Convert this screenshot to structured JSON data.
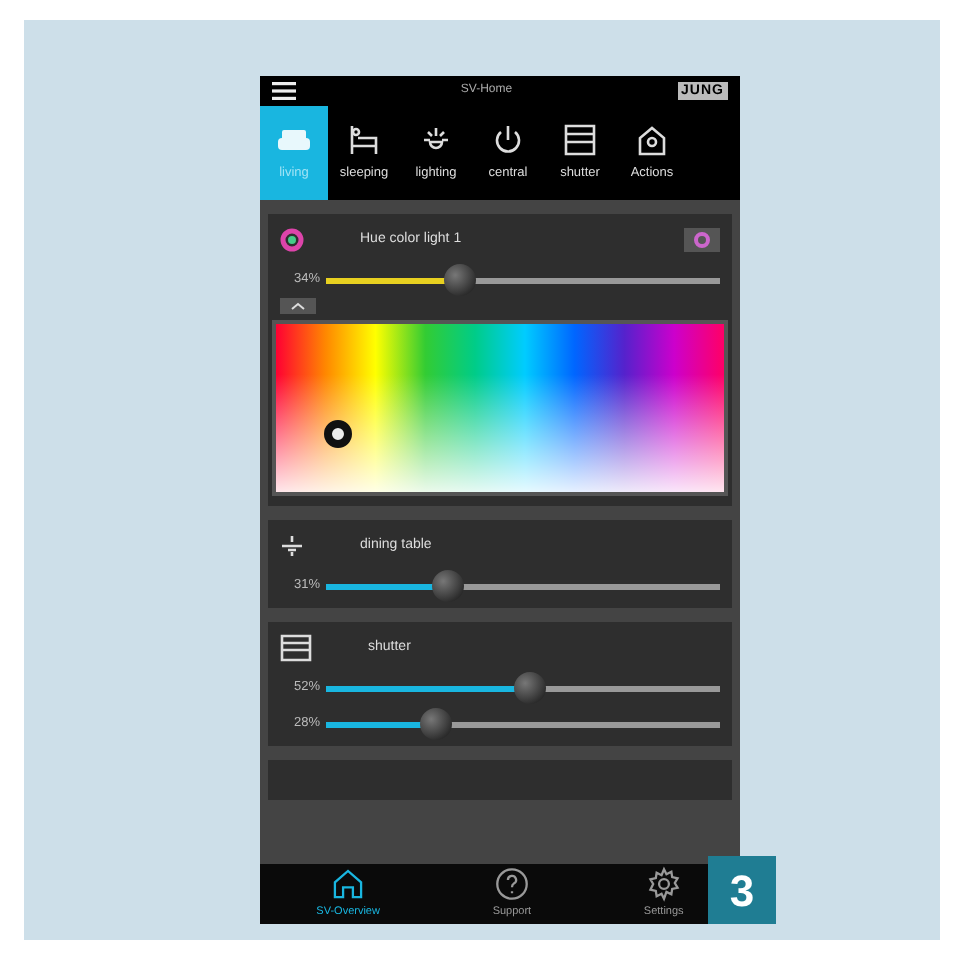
{
  "header": {
    "title": "SV-Home",
    "logo": "JUNG"
  },
  "tabs": [
    {
      "kind": "sofa",
      "label": "living",
      "selected": true
    },
    {
      "kind": "bed",
      "label": "sleeping",
      "selected": false
    },
    {
      "kind": "lamp",
      "label": "lighting",
      "selected": false
    },
    {
      "kind": "power",
      "label": "central",
      "selected": false
    },
    {
      "kind": "shutter",
      "label": "shutter",
      "selected": false
    },
    {
      "kind": "house",
      "label": "Actions",
      "selected": false
    }
  ],
  "cards": [
    {
      "kind": "color",
      "title": "Hue color light 1",
      "sliders": [
        {
          "reading": "34%",
          "level": 0.34,
          "color": "#e8d020"
        }
      ]
    },
    {
      "kind": "lamp",
      "title": "dining table",
      "sliders": [
        {
          "reading": "31%",
          "level": 0.31,
          "color": "#19b6e0"
        }
      ]
    },
    {
      "kind": "shutter",
      "title": "shutter",
      "sliders": [
        {
          "reading": "52%",
          "level": 0.52,
          "color": "#19b6e0"
        },
        {
          "reading": "28%",
          "level": 0.28,
          "color": "#19b6e0"
        }
      ]
    }
  ],
  "nav": [
    {
      "kind": "home",
      "label": "SV-Overview",
      "selected": true
    },
    {
      "kind": "help",
      "label": "Support",
      "selected": false
    },
    {
      "kind": "gear",
      "label": "Settings",
      "selected": false
    }
  ],
  "badge": "3"
}
